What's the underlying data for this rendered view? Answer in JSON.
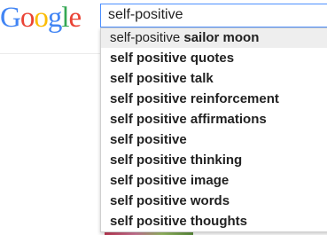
{
  "logo": {
    "letters": [
      "G",
      "o",
      "o",
      "g",
      "l",
      "e"
    ],
    "colors": [
      "#4285f4",
      "#ea4335",
      "#fbbc05",
      "#4285f4",
      "#34a853",
      "#ea4335"
    ]
  },
  "search": {
    "value": "self-positive"
  },
  "suggestions": [
    {
      "prefix": "self-positive ",
      "suffix": "sailor moon",
      "selected": true
    },
    {
      "prefix": "",
      "suffix": "self positive quotes",
      "selected": false
    },
    {
      "prefix": "",
      "suffix": "self positive talk",
      "selected": false
    },
    {
      "prefix": "",
      "suffix": "self positive reinforcement",
      "selected": false
    },
    {
      "prefix": "",
      "suffix": "self positive affirmations",
      "selected": false
    },
    {
      "prefix": "",
      "suffix": "self positive",
      "selected": false
    },
    {
      "prefix": "",
      "suffix": "self positive thinking",
      "selected": false
    },
    {
      "prefix": "",
      "suffix": "self positive image",
      "selected": false
    },
    {
      "prefix": "",
      "suffix": "self positive words",
      "selected": false
    },
    {
      "prefix": "",
      "suffix": "self positive thoughts",
      "selected": false
    }
  ],
  "colors": {
    "focus_border": "#4d90fe",
    "selected_bg": "#eeeeee",
    "text": "#222222"
  }
}
